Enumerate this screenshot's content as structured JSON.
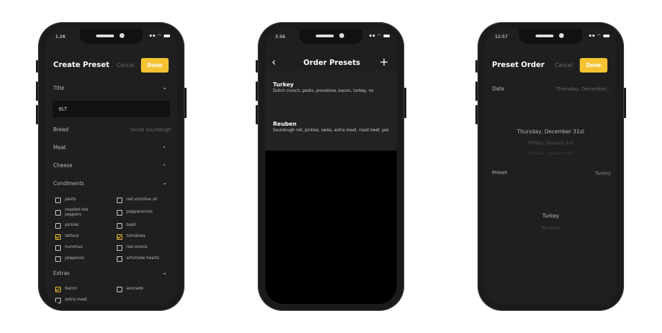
{
  "colors": {
    "accent": "#f5c332",
    "screen_bg": "#1f1f1f",
    "muted": "#6c6c6c"
  },
  "phone1": {
    "status_time": "1:26",
    "nav": {
      "title": "Create Preset",
      "cancel": "Cancel",
      "done": "Done"
    },
    "title_label": "Title",
    "title_value": "BLT",
    "bread_label": "Bread",
    "bread_value": "sliced sourdough",
    "meat_label": "Meat",
    "cheese_label": "Cheese",
    "condiments_label": "Condiments",
    "condiments": [
      {
        "label": "pesto",
        "checked": false
      },
      {
        "label": "red vin/olive oil",
        "checked": false
      },
      {
        "label": "roasted red peppers",
        "checked": false
      },
      {
        "label": "pepperoncini",
        "checked": false
      },
      {
        "label": "pickles",
        "checked": false
      },
      {
        "label": "basil",
        "checked": false
      },
      {
        "label": "lettuce",
        "checked": true
      },
      {
        "label": "tomatoes",
        "checked": true
      },
      {
        "label": "hummus",
        "checked": false
      },
      {
        "label": "red onions",
        "checked": false
      },
      {
        "label": "jalapenos",
        "checked": false
      },
      {
        "label": "artichoke hearts",
        "checked": false
      }
    ],
    "extras_label": "Extras",
    "extras": [
      {
        "label": "bacon",
        "checked": true
      },
      {
        "label": "avocado",
        "checked": false
      },
      {
        "label": "extra meat",
        "checked": false
      }
    ]
  },
  "phone2": {
    "status_time": "3:56",
    "nav": {
      "title": "Order Presets",
      "back_icon": "chevron-left-icon",
      "add_icon": "plus-icon"
    },
    "presets": [
      {
        "name": "Turkey",
        "desc": "Dutch crunch, pesto, provolone, bacon, turkey, no"
      },
      {
        "name": "Reuben",
        "desc": "Sourdough roll, pickles, swiss, extra meat, roast beef, yes"
      }
    ]
  },
  "phone3": {
    "status_time": "12:57",
    "nav": {
      "title": "Preset Order",
      "cancel": "Cancel",
      "done": "Done"
    },
    "date_label": "Date",
    "date_value": "Thursday, December...",
    "date_picker": [
      "Thursday, December 31st",
      "Friday, January 1st",
      "Monday, January 4th"
    ],
    "preset_label": "Preset",
    "preset_value": "Turkey",
    "preset_picker": [
      "Turkey",
      "Reuben"
    ]
  }
}
